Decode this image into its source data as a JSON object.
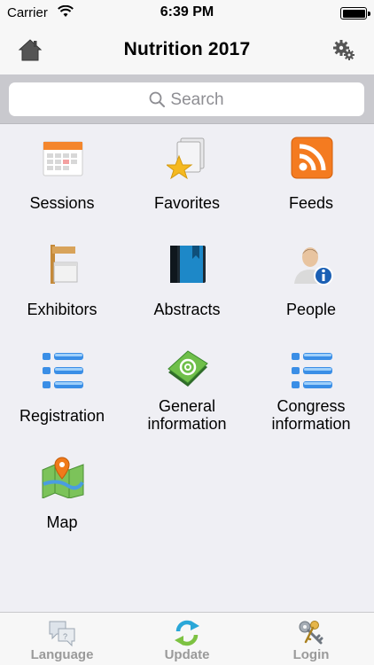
{
  "status": {
    "carrier": "Carrier",
    "time": "6:39 PM"
  },
  "nav": {
    "title": "Nutrition 2017"
  },
  "search": {
    "placeholder": "Search"
  },
  "menu": [
    {
      "label": "Sessions",
      "icon": "calendar-icon"
    },
    {
      "label": "Favorites",
      "icon": "favorites-star-icon"
    },
    {
      "label": "Feeds",
      "icon": "rss-feed-icon"
    },
    {
      "label": "Exhibitors",
      "icon": "exhibitor-booth-icon"
    },
    {
      "label": "Abstracts",
      "icon": "book-icon"
    },
    {
      "label": "People",
      "icon": "person-info-icon"
    },
    {
      "label": "Registration",
      "icon": "list-icon"
    },
    {
      "label": "General information",
      "line1": "General",
      "line2": "information",
      "icon": "email-book-icon"
    },
    {
      "label": "Congress information",
      "line1": "Congress",
      "line2": "information",
      "icon": "list-icon"
    },
    {
      "label": "Map",
      "icon": "map-pin-icon"
    }
  ],
  "tabs": [
    {
      "label": "Language",
      "icon": "language-icon"
    },
    {
      "label": "Update",
      "icon": "update-refresh-icon"
    },
    {
      "label": "Login",
      "icon": "keys-icon"
    }
  ],
  "colors": {
    "accent_orange": "#f47b20",
    "list_blue": "#3a8ee6",
    "tab_label_gray": "#9a9a9a"
  }
}
